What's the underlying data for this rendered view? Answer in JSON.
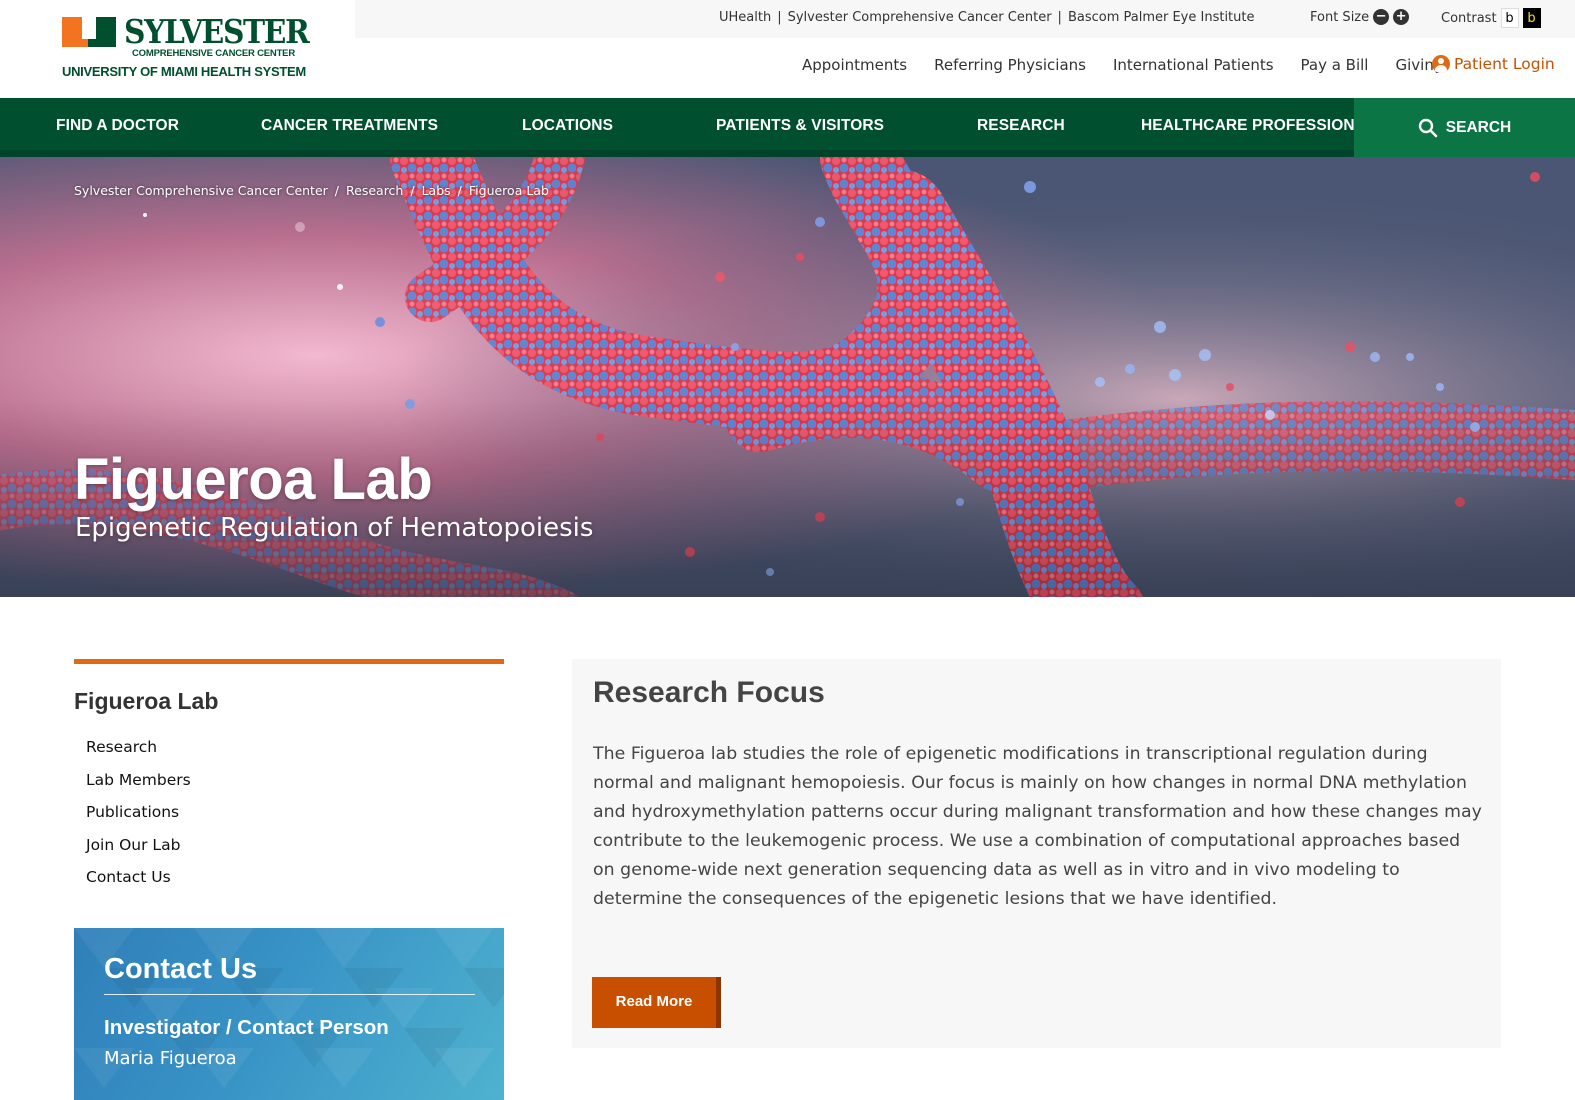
{
  "logo": {
    "title": "SYLVESTER",
    "subtitle": "COMPREHENSIVE CANCER CENTER",
    "system": "UNIVERSITY OF MIAMI HEALTH SYSTEM",
    "colors": {
      "green": "#005030",
      "orange": "#f47321"
    }
  },
  "utility": {
    "links": [
      "UHealth",
      "Sylvester Comprehensive Cancer Center",
      "Bascom Palmer Eye Institute"
    ],
    "separator": "|",
    "font_size_label": "Font Size",
    "font_decrease": "−",
    "font_increase": "+",
    "contrast_label": "Contrast",
    "contrast_light": "b",
    "contrast_dark": "b"
  },
  "secondary_nav": {
    "items": [
      "Appointments",
      "Referring Physicians",
      "International Patients",
      "Pay a Bill",
      "Giving"
    ],
    "patient_login": "Patient Login",
    "login_color": "#c75100"
  },
  "main_nav": {
    "items": [
      "FIND A DOCTOR",
      "CANCER TREATMENTS",
      "LOCATIONS",
      "PATIENTS & VISITORS",
      "RESEARCH",
      "HEALTHCARE PROFESSIONALS"
    ],
    "search": "SEARCH",
    "colors": {
      "bar": "#005030",
      "search": "#0b7545"
    }
  },
  "breadcrumb": [
    "Sylvester Comprehensive Cancer Center",
    "Research",
    "Labs",
    "Figueroa Lab"
  ],
  "breadcrumb_sep": "/",
  "hero": {
    "title": "Figueroa Lab",
    "subtitle": "Epigenetic Regulation of Hematopoiesis"
  },
  "sidebar": {
    "title": "Figueroa Lab",
    "links": [
      "Research",
      "Lab Members",
      "Publications",
      "Join Our Lab",
      "Contact Us"
    ],
    "accent": "#e06a13"
  },
  "contact": {
    "title": "Contact Us",
    "label": "Investigator / Contact Person",
    "name": "Maria Figueroa"
  },
  "content": {
    "heading": "Research Focus",
    "body": "The Figueroa lab studies the role of epigenetic modifications in transcriptional regulation during normal and malignant hemopoiesis. Our focus is mainly on how changes in normal DNA methylation and hydroxymethylation patterns occur during malignant transformation and how these changes may contribute to the leukemogenic process. We use a combination of computational approaches based on genome-wide next generation sequencing data as well as in vitro and in vivo modeling to determine the consequences of the epigenetic lesions that we have identified.",
    "button": "Read More",
    "button_color": "#c94f00"
  }
}
